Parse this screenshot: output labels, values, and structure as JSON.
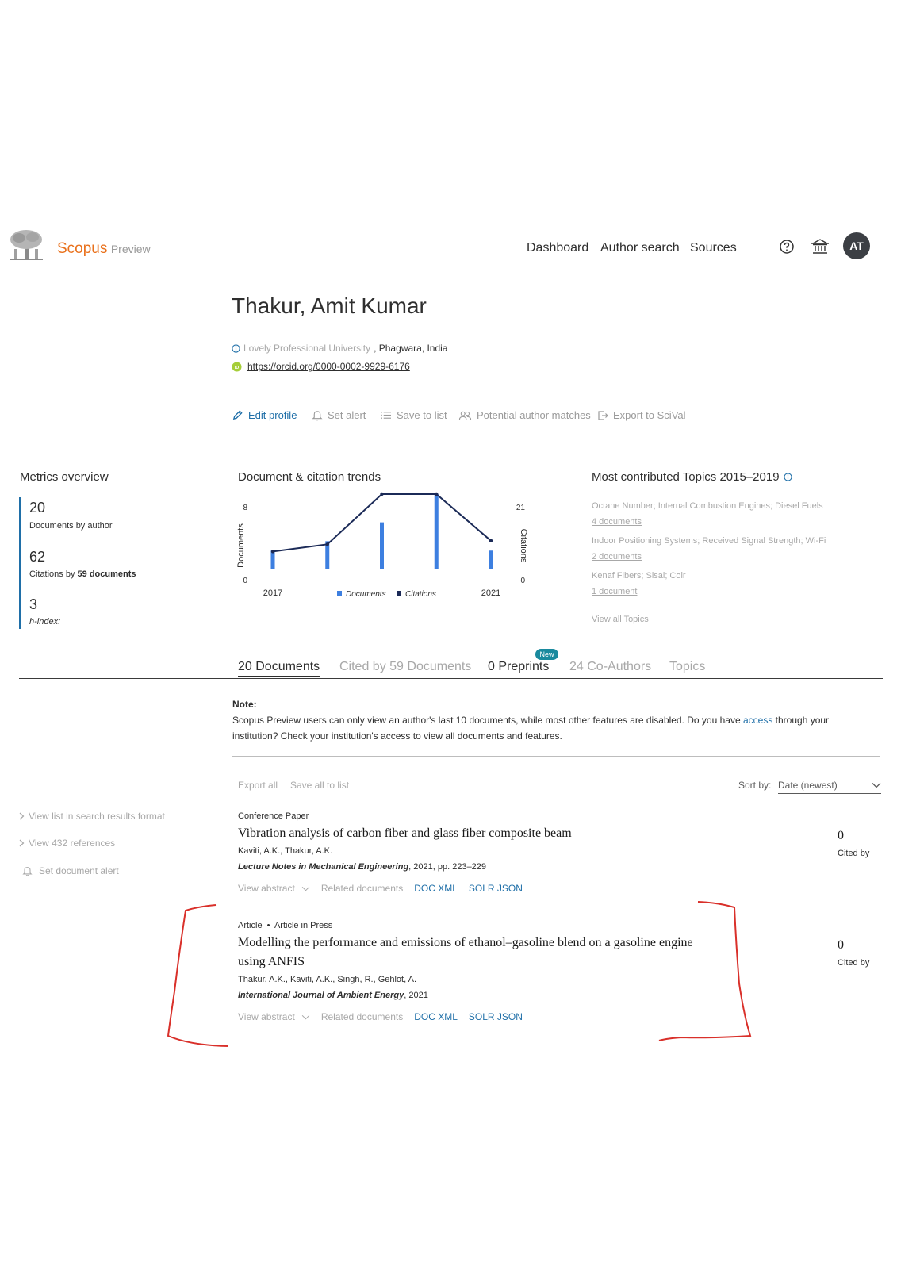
{
  "header": {
    "brand": "Scopus",
    "brand_suffix": "Preview",
    "nav": [
      "Dashboard",
      "Author search",
      "Sources"
    ],
    "avatar_initials": "AT",
    "brand_color": "#e9711c"
  },
  "profile": {
    "name": "Thakur, Amit Kumar",
    "affiliation_link": "Lovely Professional University",
    "affiliation_location": ", Phagwara, India",
    "orcid_url": "https://orcid.org/0000-0002-9929-6176",
    "actions": [
      "Edit profile",
      "Set alert",
      "Save to list",
      "Potential author matches",
      "Export to SciVal"
    ]
  },
  "metrics": {
    "title": "Metrics overview",
    "documents_value": "20",
    "documents_label": "Documents by author",
    "citations_value": "62",
    "citations_label_prefix": "Citations by ",
    "citations_label_bold": "59 documents",
    "hindex_value": "3",
    "hindex_label": "h-index:"
  },
  "trends": {
    "title": "Document & citation trends",
    "left_axis_label": "Documents",
    "right_axis_label": "Citations",
    "left_top": "8",
    "left_bottom": "0",
    "right_top": "21",
    "right_bottom": "0",
    "x_start": "2017",
    "x_end": "2021",
    "legend_documents": "Documents",
    "legend_citations": "Citations"
  },
  "chart_data": {
    "type": "bar",
    "x": [
      2017,
      2018,
      2019,
      2020,
      2021
    ],
    "series": [
      {
        "name": "Documents",
        "kind": "bar",
        "axis": "left",
        "values": [
          2,
          3,
          5,
          8,
          2
        ]
      },
      {
        "name": "Citations",
        "kind": "line",
        "axis": "right",
        "values": [
          5,
          7,
          21,
          21,
          8
        ]
      }
    ],
    "ylim_left": [
      0,
      8
    ],
    "ylim_right": [
      0,
      21
    ],
    "bar_color": "#3d7fe0",
    "line_color": "#1b2a57"
  },
  "topics": {
    "title": "Most contributed Topics 2015–2019",
    "items": [
      {
        "name": "Octane Number; Internal Combustion Engines; Diesel Fuels",
        "count": "4 documents"
      },
      {
        "name": "Indoor Positioning Systems; Received Signal Strength; Wi-Fi",
        "count": "2 documents"
      },
      {
        "name": "Kenaf Fibers; Sisal; Coir",
        "count": "1 document"
      }
    ],
    "view_all": "View all Topics"
  },
  "tabs": {
    "items": [
      "20 Documents",
      "Cited by 59 Documents",
      "0 Preprints",
      "24 Co-Authors",
      "Topics"
    ],
    "new_badge": "New"
  },
  "note": {
    "heading": "Note:",
    "text_before": "Scopus Preview users can only view an author's last 10 documents, while most other features are disabled. Do you have ",
    "link": "access",
    "text_after": " through your institution? Check your institution's access to view all documents and features."
  },
  "toolbar": {
    "export_all": "Export all",
    "save_all": "Save all to list",
    "sort_label": "Sort by:",
    "sort_value": "Date (newest)"
  },
  "sidebar": {
    "items": [
      "View list in search results format",
      "View 432 references",
      "Set document alert"
    ]
  },
  "documents": [
    {
      "type": "Conference Paper",
      "title": "Vibration analysis of carbon fiber and glass fiber composite beam",
      "authors": "Kaviti, A.K., Thakur, A.K.",
      "source": "Lecture Notes in Mechanical Engineering",
      "source_rest": ", 2021, pp. 223–229",
      "cited_count": "0",
      "cited_label": "Cited by",
      "links": [
        "View abstract",
        "Related documents",
        "DOC XML",
        "SOLR JSON"
      ]
    },
    {
      "type": "Article",
      "type_extra": "Article in Press",
      "title": "Modelling the performance and emissions of ethanol–gasoline blend on a gasoline engine using ANFIS",
      "authors": "Thakur, A.K., Kaviti, A.K., Singh, R., Gehlot, A.",
      "source": "International Journal of Ambient Energy",
      "source_rest": ", 2021",
      "cited_count": "0",
      "cited_label": "Cited by",
      "links": [
        "View abstract",
        "Related documents",
        "DOC XML",
        "SOLR JSON"
      ]
    }
  ]
}
